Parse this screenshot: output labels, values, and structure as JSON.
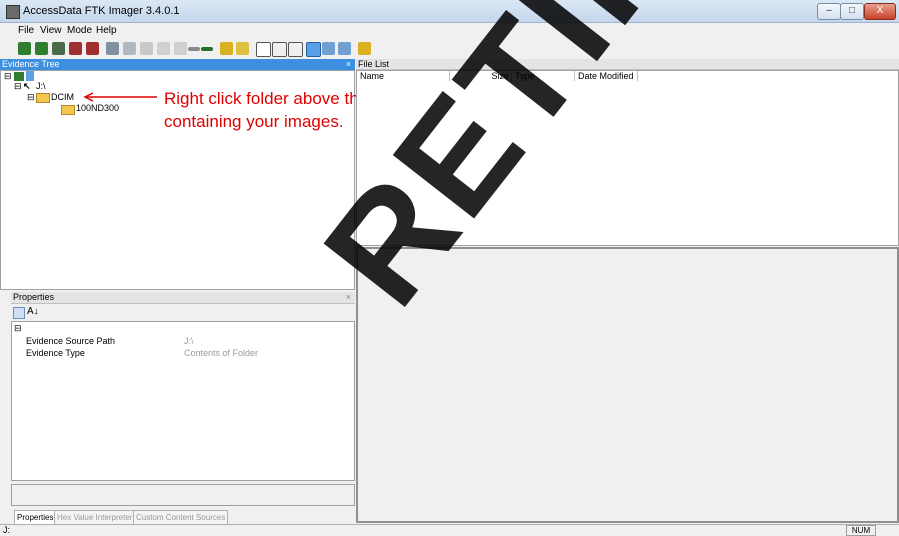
{
  "window": {
    "title": "AccessData FTK Imager 3.4.0.1",
    "min": "–",
    "max": "□",
    "close": "X"
  },
  "menu": [
    "File",
    "View",
    "Mode",
    "Help"
  ],
  "evidence_tree": {
    "header": "Evidence Tree",
    "close": "×",
    "root_label": "J:\\",
    "folder": "DCIM",
    "subfolder": "100ND300"
  },
  "file_list": {
    "header": "File List",
    "columns": [
      "Name",
      "Size",
      "Type",
      "Date Modified"
    ]
  },
  "properties": {
    "header": "Properties",
    "close": "×",
    "rows": [
      {
        "name": "Evidence Source Path",
        "value": "J:\\"
      },
      {
        "name": "Evidence Type",
        "value": "Contents of Folder"
      }
    ]
  },
  "tabs": [
    "Properties",
    "Hex Value Interpreter",
    "Custom Content Sources"
  ],
  "status": {
    "left": "J:",
    "num": "NUM"
  },
  "annotation": {
    "line1": "Right click folder above the folder",
    "line2": "containing your images."
  },
  "watermark": "RETIRED",
  "colors": {
    "accent": "#3d8fe0",
    "annotation": "#e00000"
  }
}
